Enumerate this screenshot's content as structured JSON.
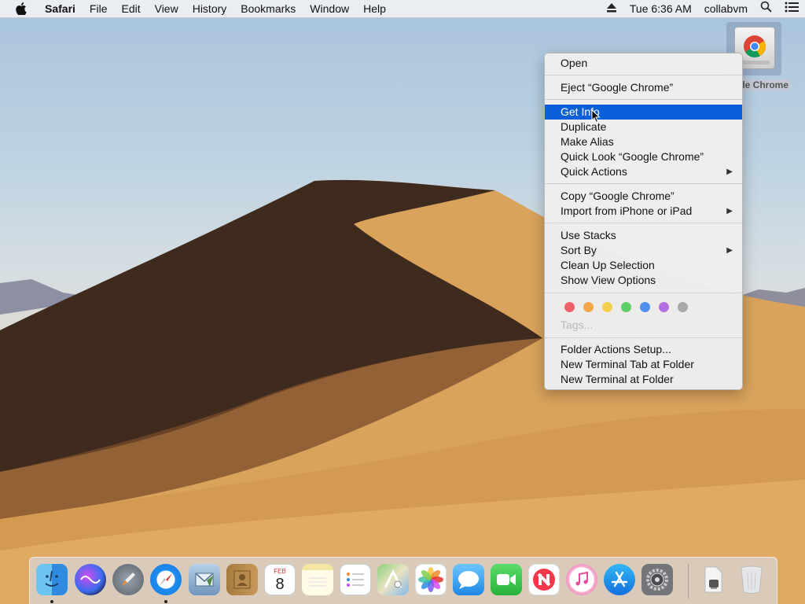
{
  "menubar": {
    "apple_icon": "apple-logo-icon",
    "app_name": "Safari",
    "menus": [
      "File",
      "Edit",
      "View",
      "History",
      "Bookmarks",
      "Window",
      "Help"
    ],
    "clock": "Tue 6:36 AM",
    "user": "collabvm"
  },
  "desktop": {
    "icon_label": "le Chrome"
  },
  "context_menu": {
    "open": "Open",
    "eject": "Eject “Google Chrome”",
    "get_info": "Get Info",
    "duplicate": "Duplicate",
    "make_alias": "Make Alias",
    "quick_look": "Quick Look “Google Chrome”",
    "quick_actions": "Quick Actions",
    "copy": "Copy “Google Chrome”",
    "import_iphone": "Import from iPhone or iPad",
    "use_stacks": "Use Stacks",
    "sort_by": "Sort By",
    "clean_up": "Clean Up Selection",
    "show_view_options": "Show View Options",
    "tags": "Tags...",
    "tag_colors": [
      "#f0606a",
      "#f4a64a",
      "#f2d04e",
      "#5fcf6a",
      "#4f8ff0",
      "#b370e0",
      "#a8a8ab"
    ],
    "folder_actions": "Folder Actions Setup...",
    "new_terminal_tab": "New Terminal Tab at Folder",
    "new_terminal": "New Terminal at Folder",
    "highlight_color": "#0b5fd8"
  },
  "dock": {
    "calendar_month": "FEB",
    "calendar_day": "8",
    "apps": [
      "Finder",
      "Siri",
      "Launchpad",
      "Safari",
      "Mail",
      "Contacts",
      "Calendar",
      "Notes",
      "Reminders",
      "Maps",
      "Photos",
      "Messages",
      "FaceTime",
      "News",
      "iTunes",
      "App Store",
      "System Preferences",
      "Downloads",
      "Trash"
    ]
  }
}
